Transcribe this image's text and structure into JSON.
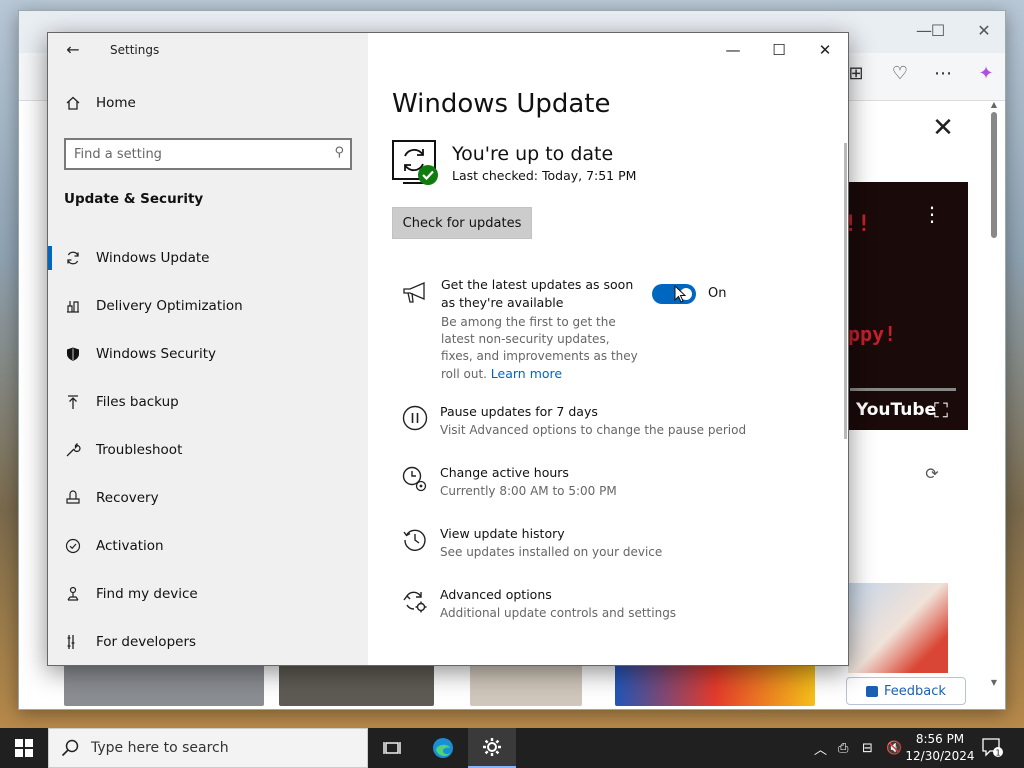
{
  "settings": {
    "window_title": "Settings",
    "nav": {
      "home_label": "Home",
      "search_placeholder": "Find a setting",
      "section_title": "Update & Security",
      "items": [
        {
          "label": "Windows Update",
          "icon": "refresh-icon",
          "active": true
        },
        {
          "label": "Delivery Optimization",
          "icon": "delivery-icon",
          "active": false
        },
        {
          "label": "Windows Security",
          "icon": "shield-icon",
          "active": false
        },
        {
          "label": "Files backup",
          "icon": "backup-arrow-icon",
          "active": false
        },
        {
          "label": "Troubleshoot",
          "icon": "wrench-icon",
          "active": false
        },
        {
          "label": "Recovery",
          "icon": "recovery-icon",
          "active": false
        },
        {
          "label": "Activation",
          "icon": "check-circle-icon",
          "active": false
        },
        {
          "label": "Find my device",
          "icon": "person-pin-icon",
          "active": false
        },
        {
          "label": "For developers",
          "icon": "developer-icon",
          "active": false
        }
      ]
    },
    "main": {
      "page_title": "Windows Update",
      "status_heading": "You're up to date",
      "last_checked": "Last checked: Today, 7:51 PM",
      "check_button": "Check for updates",
      "latest_updates": {
        "title": "Get the latest updates as soon as they're available",
        "description": "Be among the first to get the latest non-security updates, fixes, and improvements as they roll out.",
        "learn_more": "Learn more",
        "toggle_state": "On"
      },
      "options": [
        {
          "title": "Pause updates for 7 days",
          "subtitle": "Visit Advanced options to change the pause period",
          "icon": "pause-icon"
        },
        {
          "title": "Change active hours",
          "subtitle": "Currently 8:00 AM to 5:00 PM",
          "icon": "clock-icon"
        },
        {
          "title": "View update history",
          "subtitle": "See updates installed on your device",
          "icon": "history-icon"
        },
        {
          "title": "Advanced options",
          "subtitle": "Additional update controls and settings",
          "icon": "advanced-gear-icon"
        }
      ]
    }
  },
  "browser": {
    "video_label": "YouTube",
    "feedback_label": "Feedback"
  },
  "taskbar": {
    "search_placeholder": "Type here to search",
    "time": "8:56 PM",
    "date": "12/30/2024",
    "notification_count": "1"
  },
  "colors": {
    "accent": "#0067c0",
    "nav_bg": "#f0f0f0",
    "status_green": "#107c10"
  }
}
